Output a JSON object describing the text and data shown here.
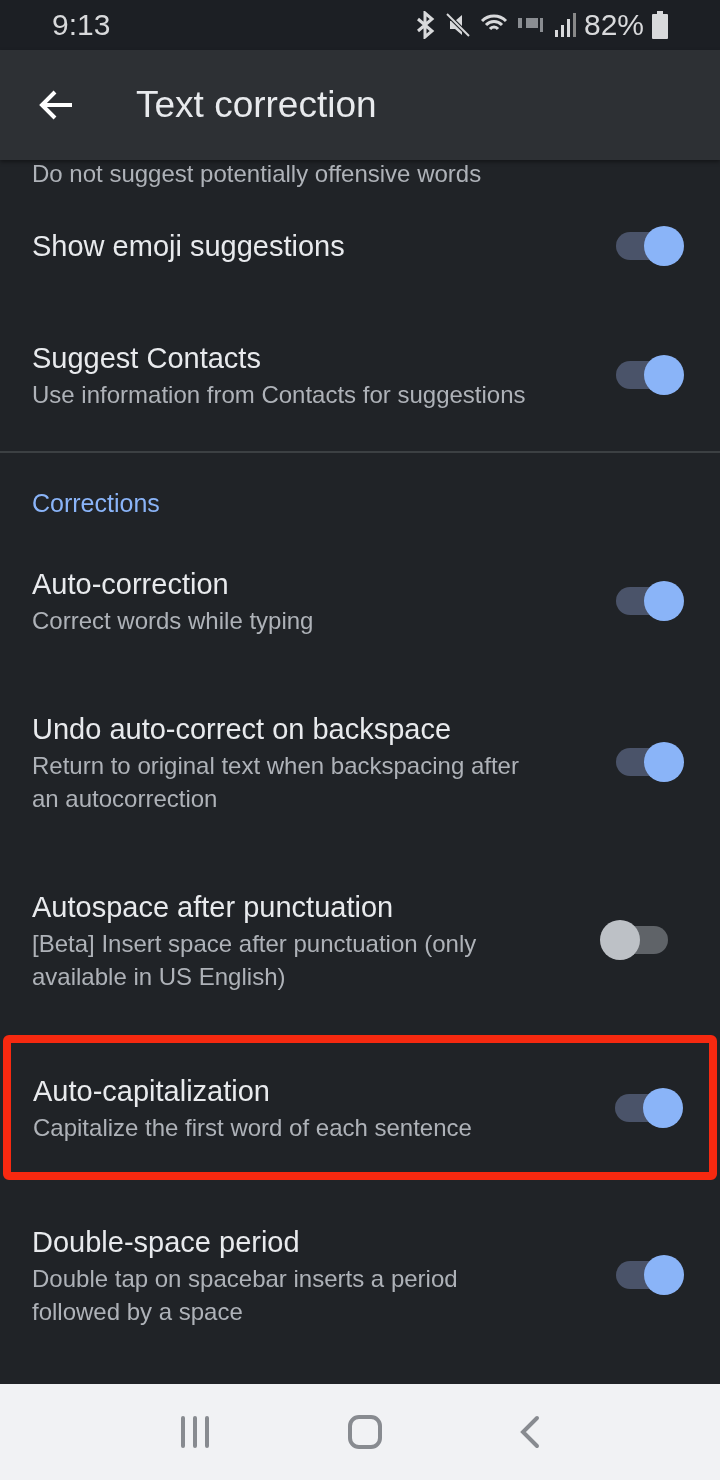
{
  "status_bar": {
    "time": "9:13",
    "battery": "82%"
  },
  "app_bar": {
    "title": "Text correction"
  },
  "items": [
    {
      "kind": "partial",
      "subtitle": "Do not suggest potentially offensive words"
    },
    {
      "kind": "toggle",
      "title": "Show emoji suggestions",
      "on": true,
      "highlighted": false
    },
    {
      "kind": "toggle",
      "title": "Suggest Contacts",
      "subtitle": "Use information from Contacts for suggestions",
      "on": true,
      "highlighted": false
    },
    {
      "kind": "divider"
    },
    {
      "kind": "header",
      "title": "Corrections"
    },
    {
      "kind": "toggle",
      "title": "Auto-correction",
      "subtitle": "Correct words while typing",
      "on": true,
      "highlighted": false
    },
    {
      "kind": "toggle",
      "title": "Undo auto-correct on backspace",
      "subtitle": "Return to original text when backspacing after an autocorrection",
      "on": true,
      "highlighted": false
    },
    {
      "kind": "toggle",
      "title": "Autospace after punctuation",
      "subtitle": "[Beta] Insert space after punctuation (only available in US English)",
      "on": false,
      "highlighted": false
    },
    {
      "kind": "toggle",
      "title": "Auto-capitalization",
      "subtitle": "Capitalize the first word of each sentence",
      "on": true,
      "highlighted": true
    },
    {
      "kind": "toggle",
      "title": "Double-space period",
      "subtitle": "Double tap on spacebar inserts a period followed by a space",
      "on": true,
      "highlighted": false
    }
  ]
}
